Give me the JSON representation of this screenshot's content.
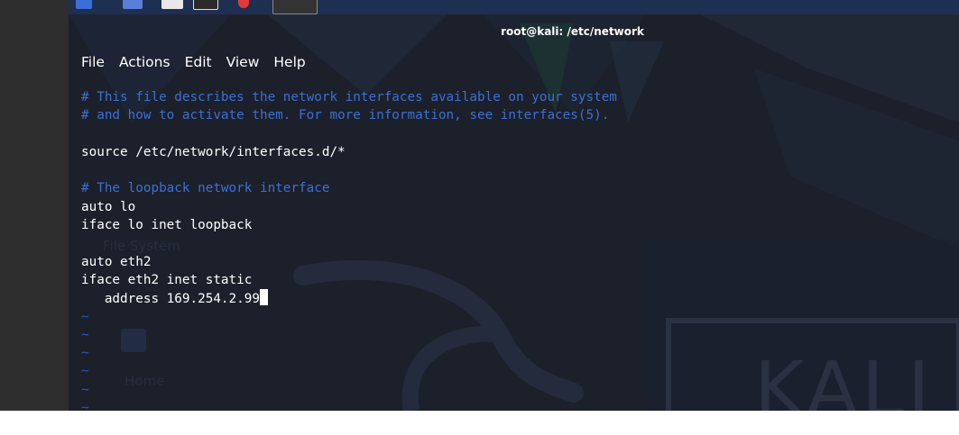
{
  "window": {
    "title": "root@kali: /etc/network"
  },
  "menu": [
    "File",
    "Actions",
    "Edit",
    "View",
    "Help"
  ],
  "editor": {
    "lines": [
      {
        "text": "# This file describes the network interfaces available on your system",
        "type": "comment"
      },
      {
        "text": "# and how to activate them. For more information, see interfaces(5).",
        "type": "comment"
      },
      {
        "text": "",
        "type": "blank"
      },
      {
        "text": "source /etc/network/interfaces.d/*",
        "type": "code"
      },
      {
        "text": "",
        "type": "blank"
      },
      {
        "text": "# The loopback network interface",
        "type": "comment"
      },
      {
        "text": "auto lo",
        "type": "code"
      },
      {
        "text": "iface lo inet loopback",
        "type": "code"
      },
      {
        "text": "",
        "type": "blank"
      },
      {
        "text": "auto eth2",
        "type": "code"
      },
      {
        "text": "iface eth2 inet static",
        "type": "code"
      },
      {
        "text": "   address 169.254.2.99",
        "type": "code",
        "cursor": true
      },
      {
        "text": "~",
        "type": "tilde"
      },
      {
        "text": "~",
        "type": "tilde"
      },
      {
        "text": "~",
        "type": "tilde"
      },
      {
        "text": "~",
        "type": "tilde"
      },
      {
        "text": "~",
        "type": "tilde"
      },
      {
        "text": "~",
        "type": "tilde"
      },
      {
        "text": "~",
        "type": "tilde"
      }
    ]
  },
  "wallpaper": {
    "brand": "KALI",
    "ghost_labels": [
      "File System",
      "Home"
    ]
  },
  "colors": {
    "terminal_bg": "#1b202b",
    "comment": "#3f6fd2",
    "tilde": "#2e58b6",
    "text": "#ffffff"
  }
}
